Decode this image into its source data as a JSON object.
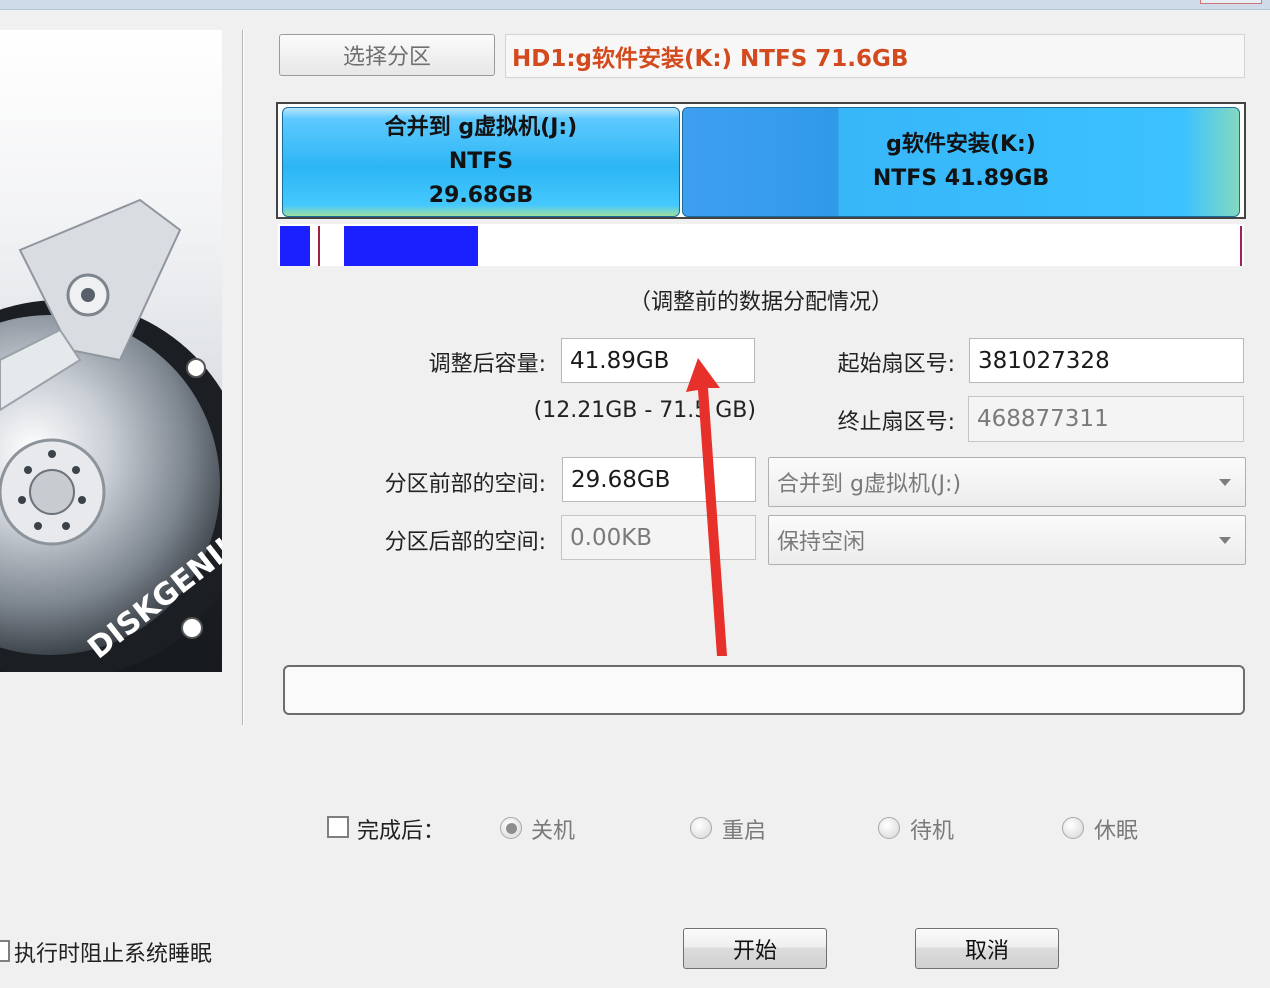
{
  "header": {
    "select_partition_button": "选择分区",
    "current_partition": "HD1:g软件安装(K:) NTFS 71.6GB"
  },
  "left_panel": {
    "brand_logo_text": "DISKGENIUS"
  },
  "partition_map": {
    "partitions": [
      {
        "line1": "合并到 g虚拟机(J:)",
        "line2": "NTFS",
        "line3": "29.68GB"
      },
      {
        "line1": "g软件安装(K:)",
        "line2": "NTFS 41.89GB"
      }
    ],
    "caption": "（调整前的数据分配情况）"
  },
  "form": {
    "new_size_label": "调整后容量:",
    "new_size_value": "41.89GB",
    "size_range": "(12.21GB - 71.5  GB)",
    "start_sector_label": "起始扇区号:",
    "start_sector_value": "381027328",
    "end_sector_label": "终止扇区号:",
    "end_sector_value": "468877311",
    "space_before_label": "分区前部的空间:",
    "space_before_value": "29.68GB",
    "space_before_action": "合并到 g虚拟机(J:)",
    "space_after_label": "分区后部的空间:",
    "space_after_value": "0.00KB",
    "space_after_action": "保持空闲"
  },
  "progress": {
    "value": 0
  },
  "after_completion": {
    "label": "完成后：",
    "checked": false,
    "options": [
      {
        "label": "关机",
        "selected": true
      },
      {
        "label": "重启",
        "selected": false
      },
      {
        "label": "待机",
        "selected": false
      },
      {
        "label": "休眠",
        "selected": false
      }
    ]
  },
  "footer": {
    "prevent_sleep_label": "执行时阻止系统睡眠",
    "start_button": "开始",
    "cancel_button": "取消"
  },
  "colors": {
    "accent_text": "#d24a1d",
    "partition_fill": "#2cb6f4",
    "usage_fill": "#1a20ff",
    "annotation_arrow": "#e8302a"
  }
}
